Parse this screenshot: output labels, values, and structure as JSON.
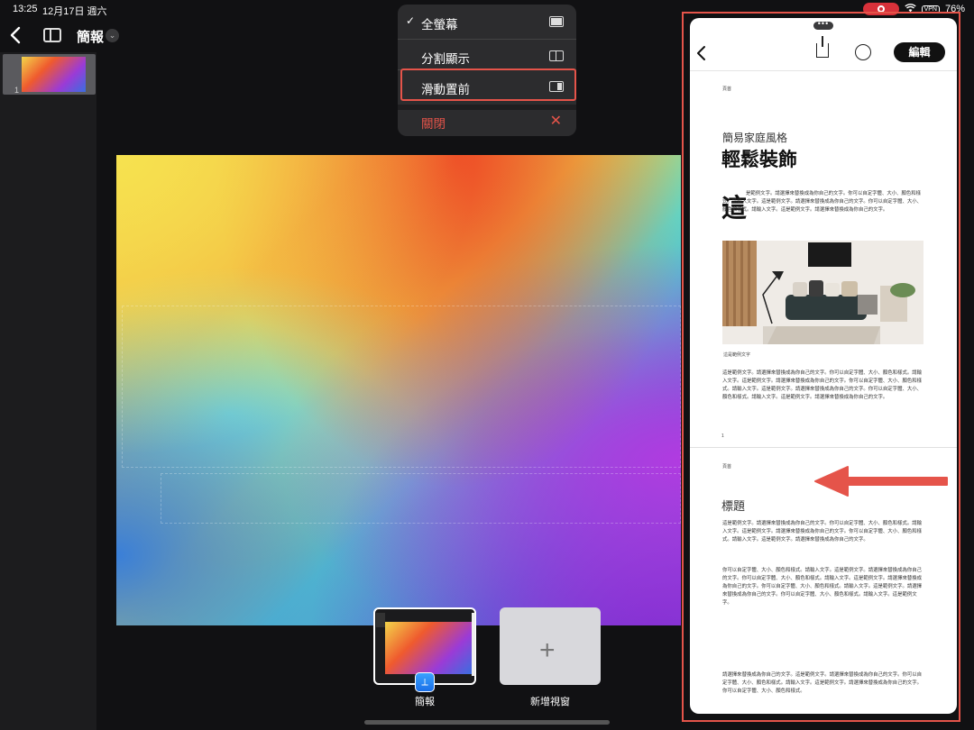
{
  "status_bar": {
    "time": "13:25",
    "date": "12月17日 週六",
    "vpn": "VPN",
    "battery": "76%"
  },
  "toolbar": {
    "title": "簡報"
  },
  "slides_panel": {
    "slide_number": "1"
  },
  "multitask_menu": {
    "items": [
      {
        "label": "全螢幕",
        "checked": true,
        "icon": "fullscreen-icon"
      },
      {
        "label": "分割顯示",
        "icon": "split-view-icon"
      },
      {
        "label": "滑動置前",
        "icon": "slide-over-icon"
      },
      {
        "label": "關閉",
        "icon": "close-icon",
        "color": "#e5544a"
      }
    ]
  },
  "app_switcher": {
    "current_app": "簡報",
    "new_window": "新增視窗"
  },
  "slide_over": {
    "edit_button": "編輯",
    "page1": {
      "header": "頁首",
      "kicker": "簡易家庭風格",
      "title": "輕鬆裝飾",
      "drop_cap": "這",
      "intro_text": "是範例文字。請選擇來替換成為你自己的文字。你可以自定字體、大小、顏色和樣式。請輸入文字。這是範例文字。請選擇來替換成為你自己的文字。你可以自定字體、大小、顏色和樣式。請輸入文字。這是範例文字。請選擇來替換成為你自己的文字。",
      "caption": "這是範例文字",
      "body": "這是範例文字。請選擇來替換成為你自己的文字。你可以自定字體、大小、顏色和樣式。請輸入文字。這是範例文字。請選擇來替換成為你自己的文字。你可以自定字體、大小、顏色和樣式。請輸入文字。這是範例文字。請選擇來替換成為你自己的文字。你可以自定字體、大小、顏色和樣式。請輸入文字。這是範例文字。請選擇來替換成為你自己的文字。",
      "page_number": "1"
    },
    "page2": {
      "header": "頁首",
      "heading": "標題",
      "body1": "這是範例文字。請選擇來替換成為你自己的文字。你可以自定字體、大小、顏色和樣式。請輸入文字。這是範例文字。請選擇來替換成為你自己的文字。你可以自定字體、大小、顏色和樣式。請輸入文字。這是範例文字。請選擇來替換成為你自己的文字。",
      "body2": "你可以自定字體、大小、顏色和樣式。請輸入文字。這是範例文字。請選擇來替換成為你自己的文字。你可以自定字體、大小、顏色和樣式。請輸入文字。這是範例文字。請選擇來替換成為你自己的文字。你可以自定字體、大小、顏色和樣式。請輸入文字。這是範例文字。請選擇來替換成為你自己的文字。你可以自定字體、大小、顏色和樣式。請輸入文字。這是範例文字。",
      "body3": "請選擇來替換成為你自己的文字。這是範例文字。請選擇來替換成為你自己的文字。你可以自定字體、大小、顏色和樣式。請輸入文字。這是範例文字。請選擇來替換成為你自己的文字。你可以自定字體、大小、顏色和樣式。"
    }
  },
  "colors": {
    "highlight": "#e5544a",
    "menu_bg": "#2c2c2e"
  }
}
